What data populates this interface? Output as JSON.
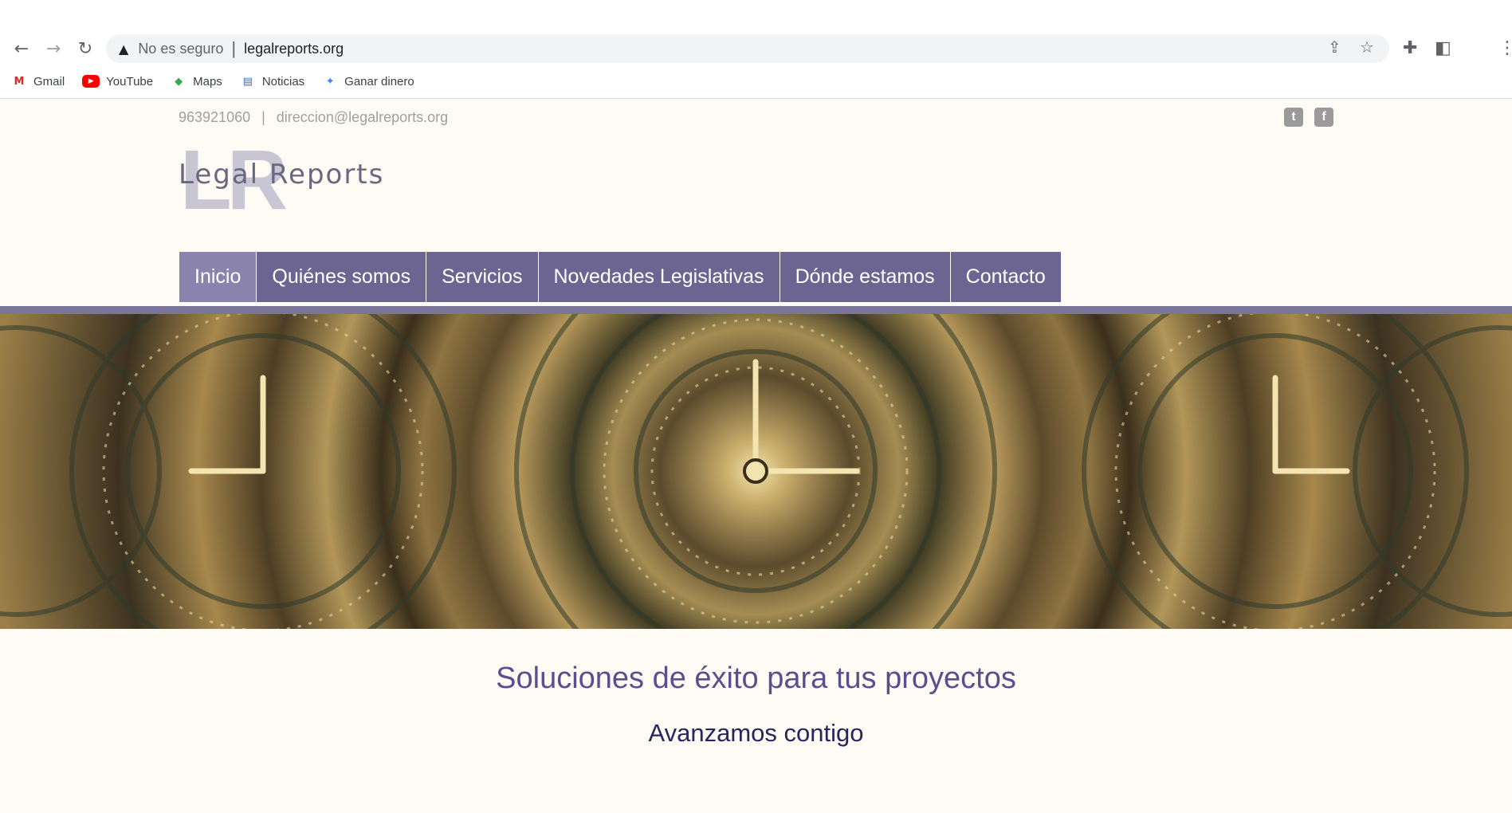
{
  "browser": {
    "security_label": "No es seguro",
    "url": "legalreports.org",
    "bookmarks": [
      {
        "label": "Gmail",
        "icon": "gmail-icon"
      },
      {
        "label": "YouTube",
        "icon": "youtube-icon"
      },
      {
        "label": "Maps",
        "icon": "maps-icon"
      },
      {
        "label": "Noticias",
        "icon": "news-icon"
      },
      {
        "label": "Ganar dinero",
        "icon": "money-icon"
      }
    ]
  },
  "site": {
    "phone": "963921060",
    "email": "direccion@legalreports.org",
    "logo_text": "Legal Reports",
    "logo_monogram": "LR",
    "nav": [
      {
        "label": "Inicio",
        "active": true
      },
      {
        "label": "Quiénes somos"
      },
      {
        "label": "Servicios"
      },
      {
        "label": "Novedades Legislativas"
      },
      {
        "label": "Dónde estamos"
      },
      {
        "label": "Contacto"
      }
    ],
    "tagline": "Soluciones de éxito para tus proyectos",
    "subtagline": "Avanzamos contigo"
  },
  "colors": {
    "nav_bg": "#6c6592",
    "nav_active": "#8a83ad",
    "tagline": "#5a4f8e",
    "page_bg": "#fdfbf4"
  }
}
